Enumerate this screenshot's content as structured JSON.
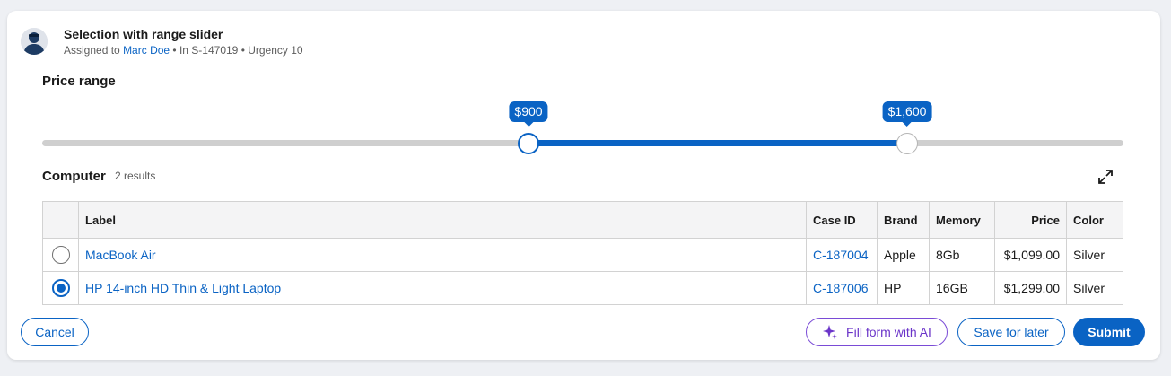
{
  "header": {
    "title": "Selection with range slider",
    "assigned_prefix": "Assigned to",
    "assignee": "Marc Doe",
    "case_ref": "• In S-147019",
    "urgency": "• Urgency 10"
  },
  "price_range": {
    "label": "Price range",
    "min_value": 900,
    "max_value": 1600,
    "min_label": "$900",
    "max_label": "$1,600",
    "active_thumb": "min"
  },
  "computer": {
    "title": "Computer",
    "count": "2 results",
    "columns": [
      "Label",
      "Case ID",
      "Brand",
      "Memory",
      "Price",
      "Color"
    ],
    "rows": [
      {
        "label": "MacBook Air",
        "case_id": "C-187004",
        "brand": "Apple",
        "memory": "8Gb",
        "price": "$1,099.00",
        "color": "Silver",
        "selected": false
      },
      {
        "label": "HP 14-inch HD Thin & Light Laptop",
        "case_id": "C-187006",
        "brand": "HP",
        "memory": "16GB",
        "price": "$1,299.00",
        "color": "Silver",
        "selected": true
      }
    ]
  },
  "actions": {
    "cancel": "Cancel",
    "fill_ai": "Fill form with AI",
    "save": "Save for later",
    "submit": "Submit"
  },
  "colors": {
    "accent": "#0a63c4",
    "ai_accent": "#7a4bd6"
  },
  "icons": {
    "avatar": "user-avatar-icon",
    "expand": "expand-icon",
    "ai": "sparkle-icon"
  }
}
